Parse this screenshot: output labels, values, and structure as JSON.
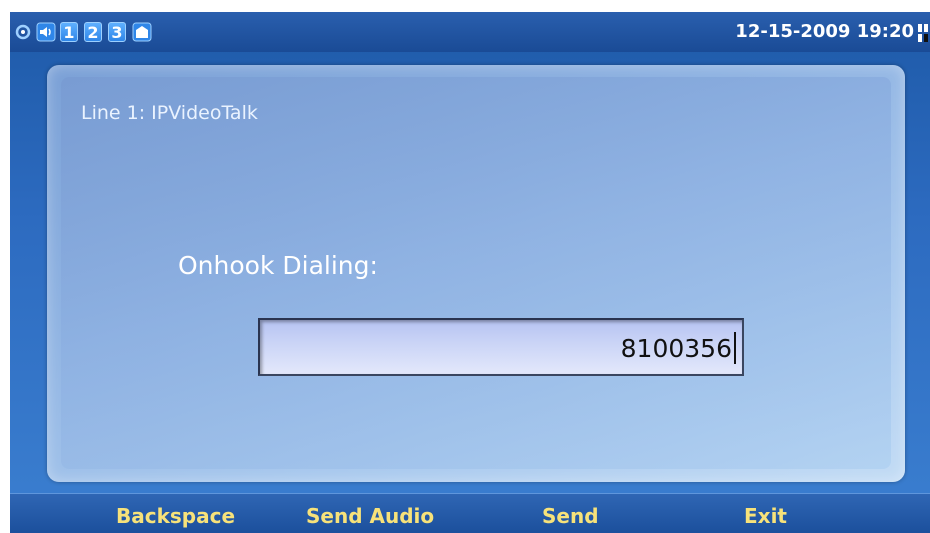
{
  "status_bar": {
    "line_keys": [
      "1",
      "2",
      "3"
    ],
    "datetime": "12-15-2009 19:20"
  },
  "panel": {
    "line_label": "Line 1: IPVideoTalk",
    "dial_title": "Onhook Dialing:",
    "dial_value": "8100356"
  },
  "softkeys": {
    "backspace": "Backspace",
    "send_audio": "Send Audio",
    "send": "Send",
    "exit": "Exit"
  },
  "colors": {
    "softkey_text": "#f7e27a",
    "status_bar": "#1a4b96"
  }
}
